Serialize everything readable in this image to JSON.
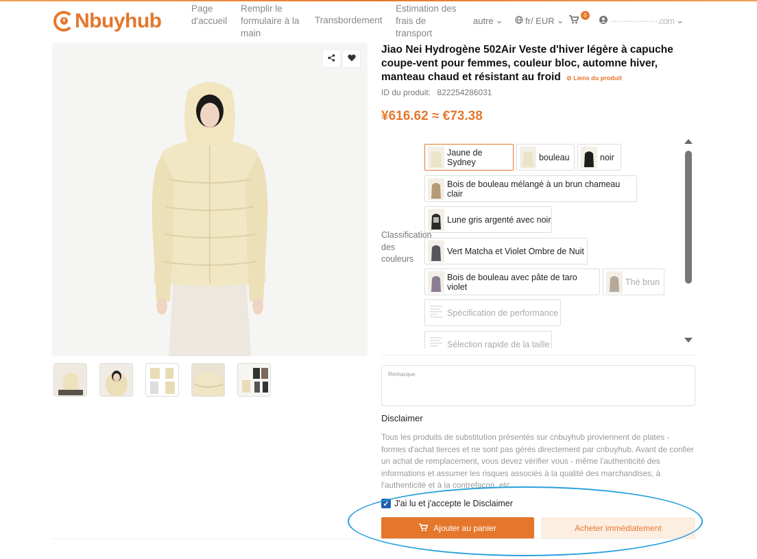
{
  "header": {
    "logo_text": "Nbuyhub",
    "logo_mark_text": "¥",
    "nav": [
      {
        "label": "Page\nd'accueil"
      },
      {
        "label": "Remplir le\nformulaire à la\nmain"
      },
      {
        "label": "Transbordement"
      },
      {
        "label": "Estimation des\nfrais de\ntransport"
      }
    ],
    "other_label": "autre",
    "lang_label": "fr/ EUR",
    "cart_count": "0",
    "account_label": "·····················.com"
  },
  "product": {
    "title": "Jiao Nei Hydrogène 502Air Veste d'hiver légère à capuche coupe-vent pour femmes, couleur bloc, automne hiver, manteau chaud et résistant au froid",
    "links_label": "Liens du produit",
    "id_label": "ID du produit:",
    "id_value": "822254286031",
    "price": "¥616.62 ≈ €73.38",
    "classification_label": "Classification des couleurs",
    "options": [
      {
        "label": "Jaune de Sydney",
        "selected": true,
        "disabled": false,
        "swatch": "#ece3c9"
      },
      {
        "label": "bouleau",
        "selected": false,
        "disabled": false,
        "swatch": "#ece3c9"
      },
      {
        "label": "noir",
        "selected": false,
        "disabled": false,
        "swatch": "#1d1d1d"
      },
      {
        "label": "Bois de bouleau mélangé à un brun chameau clair",
        "selected": false,
        "disabled": false,
        "swatch": "#b59a77"
      },
      {
        "label": "Lune gris argenté avec noir",
        "selected": false,
        "disabled": false,
        "swatch": "#8e8e8e"
      },
      {
        "label": "Vert Matcha et Violet Ombre de Nuit",
        "selected": false,
        "disabled": false,
        "swatch": "#54565c"
      },
      {
        "label": "Bois de bouleau avec pâte de taro violet",
        "selected": false,
        "disabled": false,
        "swatch": "#8a7d93"
      },
      {
        "label": "Thé brun",
        "selected": false,
        "disabled": true,
        "swatch": "#8b7a68"
      },
      {
        "label": "Spécification de performance",
        "selected": false,
        "disabled": true,
        "swatch": "#ffffff"
      },
      {
        "label": "Sélection rapide de la taille",
        "selected": false,
        "disabled": true,
        "swatch": "#ffffff"
      }
    ]
  },
  "remark": {
    "placeholder": "Remarque"
  },
  "disclaimer": {
    "title": "Disclaimer",
    "text": "Tous les produits de substitution présentés sur cnbuyhub proviennent de plates - formes d'achat tierces et ne sont pas gérés directement par cnbuyhub. Avant de confier un achat de remplacement, vous devez vérifier vous - même l'authenticité des informations et assumer les risques associés à la qualité des marchandises, à l'authenticité et à la contrefaçon, etc.",
    "accept_label": "J'ai lu et j'accepte le Disclaimer",
    "accepted": true
  },
  "actions": {
    "add_to_cart": "Ajouter au panier",
    "buy_now": "Acheter immédiatement"
  },
  "colors": {
    "accent": "#e5772d",
    "accent_light": "#fdeee2",
    "checkbox": "#1e5fb0",
    "annotation": "#27a0dd"
  }
}
